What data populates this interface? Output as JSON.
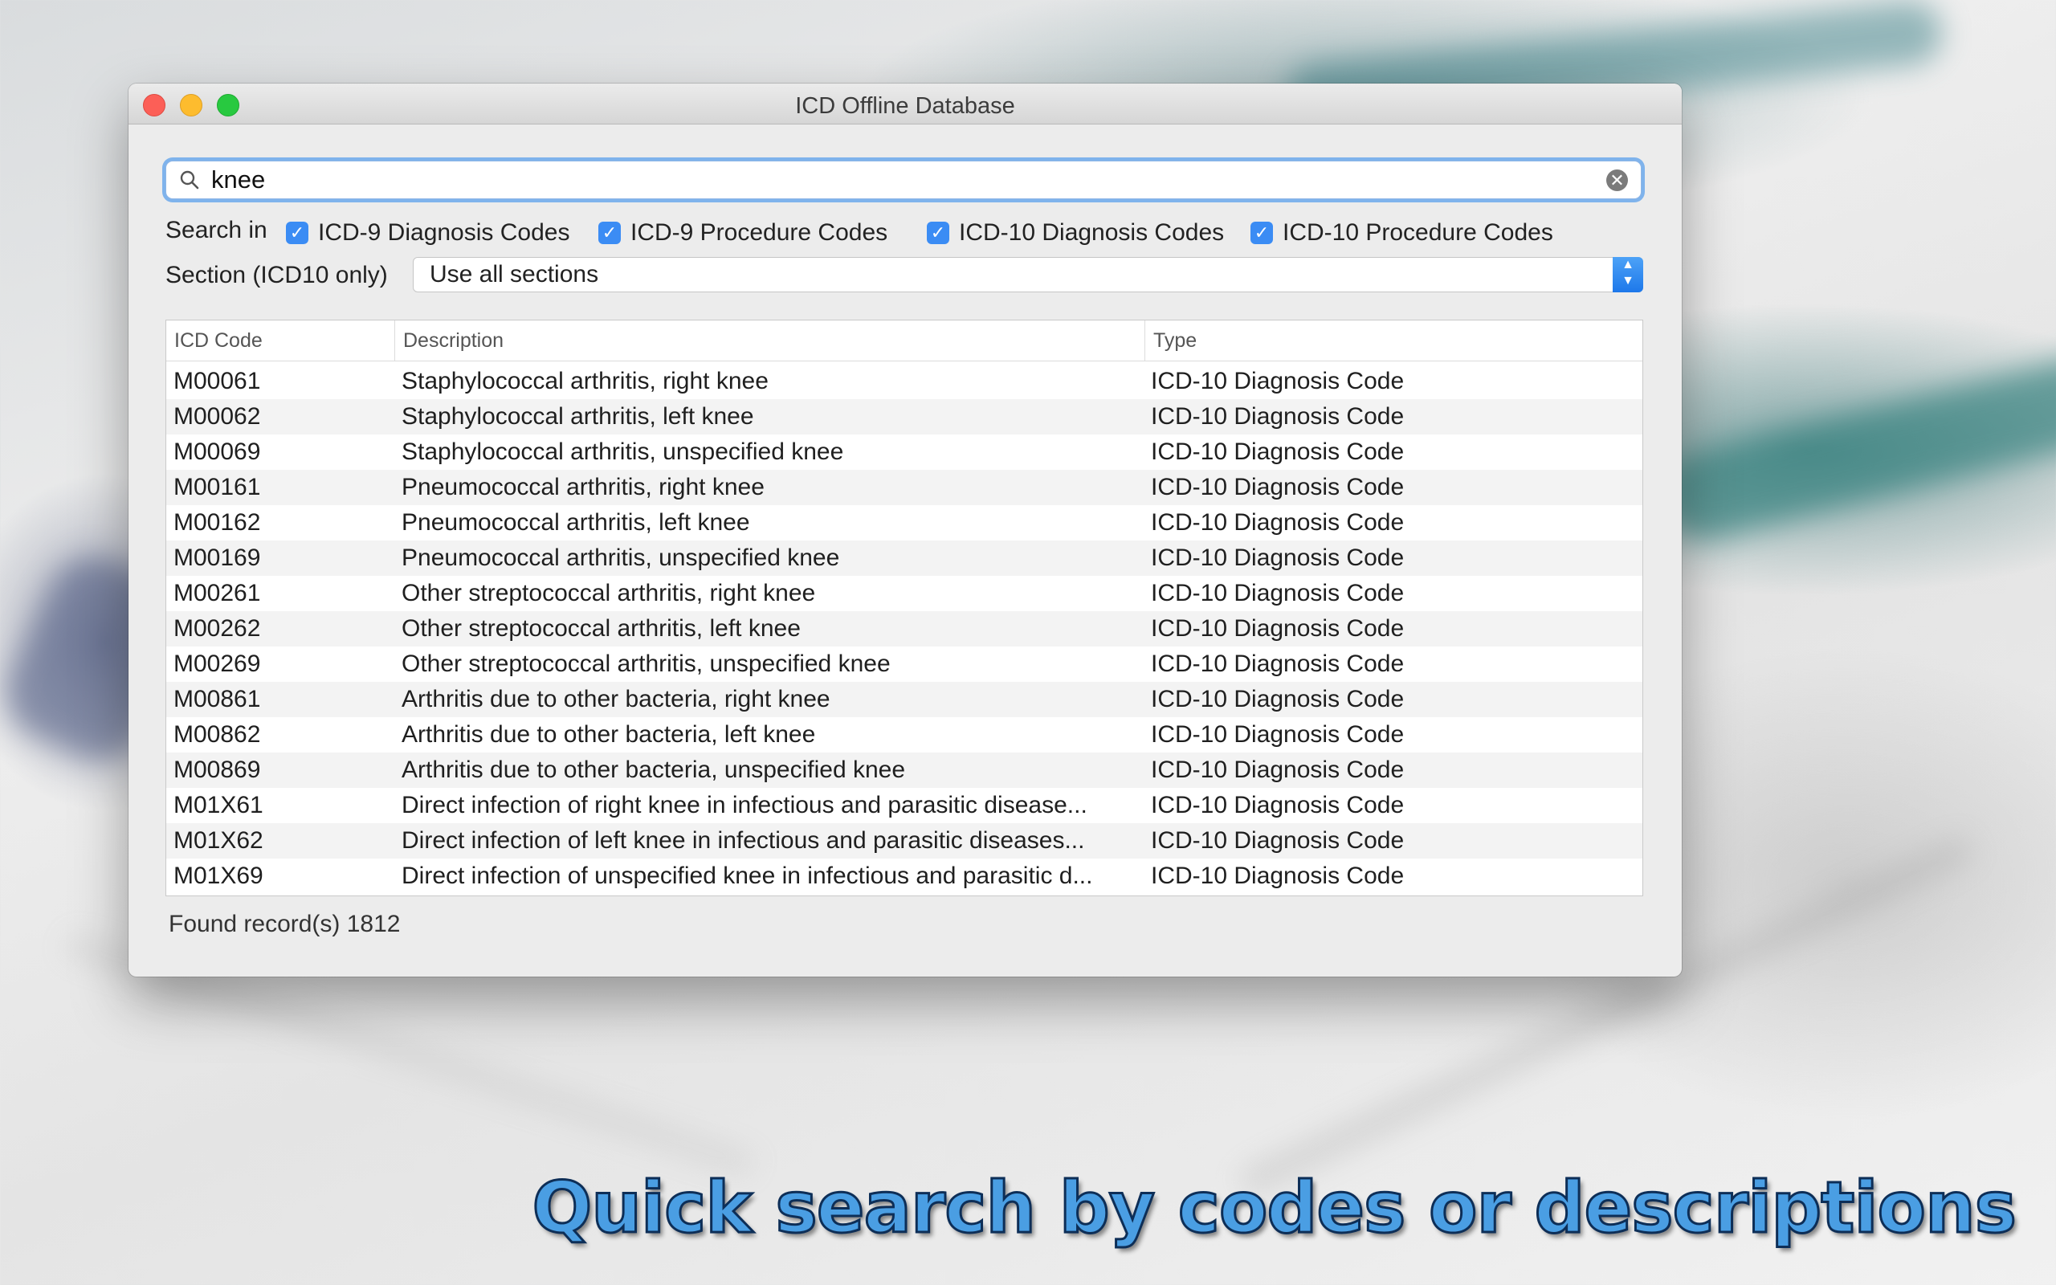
{
  "window": {
    "title": "ICD Offline Database"
  },
  "search": {
    "value": "knee",
    "icon": "magnifier",
    "clear_icon": "circle-x"
  },
  "search_in": {
    "label": "Search in",
    "options": [
      {
        "label": "ICD-9 Diagnosis Codes",
        "checked": true
      },
      {
        "label": "ICD-9 Procedure Codes",
        "checked": true
      },
      {
        "label": "ICD-10 Diagnosis Codes",
        "checked": true
      },
      {
        "label": "ICD-10 Procedure Codes",
        "checked": true
      }
    ]
  },
  "section": {
    "label": "Section (ICD10 only)",
    "value": "Use all sections"
  },
  "table": {
    "columns": [
      "ICD Code",
      "Description",
      "Type"
    ],
    "rows": [
      {
        "code": "M00061",
        "description": "Staphylococcal arthritis, right knee",
        "type": "ICD-10 Diagnosis Code"
      },
      {
        "code": "M00062",
        "description": "Staphylococcal arthritis, left knee",
        "type": "ICD-10 Diagnosis Code"
      },
      {
        "code": "M00069",
        "description": "Staphylococcal arthritis, unspecified knee",
        "type": "ICD-10 Diagnosis Code"
      },
      {
        "code": "M00161",
        "description": "Pneumococcal arthritis, right knee",
        "type": "ICD-10 Diagnosis Code"
      },
      {
        "code": "M00162",
        "description": "Pneumococcal arthritis, left knee",
        "type": "ICD-10 Diagnosis Code"
      },
      {
        "code": "M00169",
        "description": "Pneumococcal arthritis, unspecified knee",
        "type": "ICD-10 Diagnosis Code"
      },
      {
        "code": "M00261",
        "description": "Other streptococcal arthritis, right knee",
        "type": "ICD-10 Diagnosis Code"
      },
      {
        "code": "M00262",
        "description": "Other streptococcal arthritis, left knee",
        "type": "ICD-10 Diagnosis Code"
      },
      {
        "code": "M00269",
        "description": "Other streptococcal arthritis, unspecified knee",
        "type": "ICD-10 Diagnosis Code"
      },
      {
        "code": "M00861",
        "description": "Arthritis due to other bacteria, right knee",
        "type": "ICD-10 Diagnosis Code"
      },
      {
        "code": "M00862",
        "description": "Arthritis due to other bacteria, left knee",
        "type": "ICD-10 Diagnosis Code"
      },
      {
        "code": "M00869",
        "description": "Arthritis due to other bacteria, unspecified knee",
        "type": "ICD-10 Diagnosis Code"
      },
      {
        "code": "M01X61",
        "description": "Direct infection of right knee in infectious and parasitic disease...",
        "type": "ICD-10 Diagnosis Code"
      },
      {
        "code": "M01X62",
        "description": "Direct infection of left knee in infectious and parasitic diseases...",
        "type": "ICD-10 Diagnosis Code"
      },
      {
        "code": "M01X69",
        "description": "Direct infection of unspecified knee in infectious and parasitic d...",
        "type": "ICD-10 Diagnosis Code"
      }
    ]
  },
  "status": {
    "found": "Found record(s) 1812"
  },
  "caption": "Quick search by codes or descriptions",
  "colors": {
    "accent": "#3b8cf4",
    "caption": "#4a9ee3",
    "caption_outline": "#0d2e57"
  }
}
